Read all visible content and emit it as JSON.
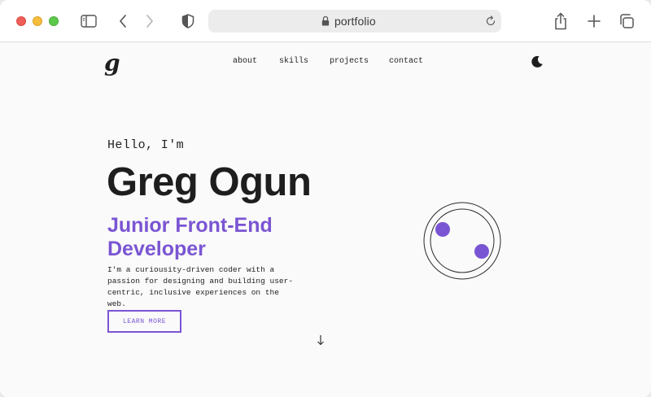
{
  "browser": {
    "url": "portfolio"
  },
  "site": {
    "logo": "g",
    "nav": {
      "about": "about",
      "skills": "skills",
      "projects": "projects",
      "contact": "contact"
    }
  },
  "hero": {
    "greeting": "Hello, I'm",
    "name": "Greg Ogun",
    "role": "Junior Front-End Developer",
    "bio": "I'm a curiousity-driven coder with a passion for designing and building user-centric, inclusive experiences on the web.",
    "cta_label": "LEARN MORE"
  },
  "colors": {
    "accent": "#7a55d3",
    "text": "#1e1e1e",
    "page_background": "#fafafa"
  },
  "icons": {
    "sidebar_toggle": "sidebar-icon",
    "back": "chevron-left-icon",
    "forward": "chevron-right-icon",
    "privacy": "shield-icon",
    "lock": "lock-icon",
    "reload": "reload-icon",
    "share": "share-icon",
    "new_tab": "plus-icon",
    "tabs": "tabs-icon",
    "theme": "moon-icon",
    "scroll": "arrow-down-icon"
  }
}
